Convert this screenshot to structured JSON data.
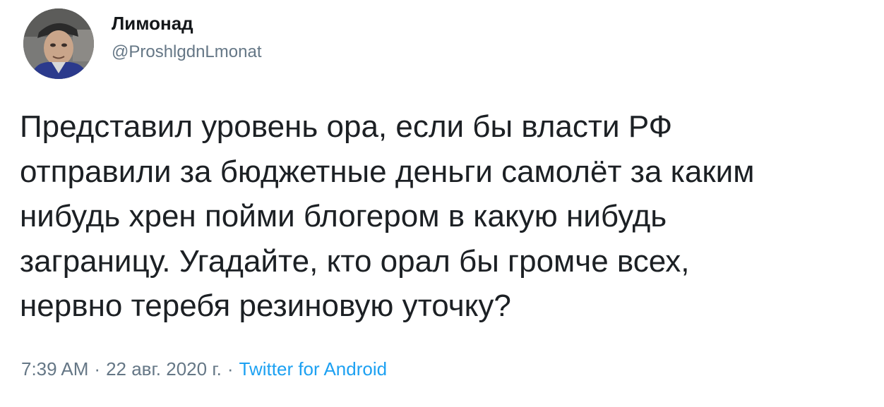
{
  "author": {
    "display_name": "Лимонад",
    "username": "@ProshlgdnLmonat"
  },
  "tweet": {
    "lines": [
      "Представил уровень ора, если бы власти РФ",
      "отправили за бюджетные деньги самолёт за каким",
      "нибудь хрен пойми блогером в какую нибудь",
      "заграницу. Угадайте, кто орал бы громче всех,",
      "нервно теребя резиновую уточку?"
    ]
  },
  "meta": {
    "time": "7:39 AM",
    "date": "22 авг. 2020 г.",
    "separator": "·",
    "source": "Twitter for Android"
  },
  "colors": {
    "text": "#1c2024",
    "secondary": "#657786",
    "link": "#1da1f2"
  }
}
